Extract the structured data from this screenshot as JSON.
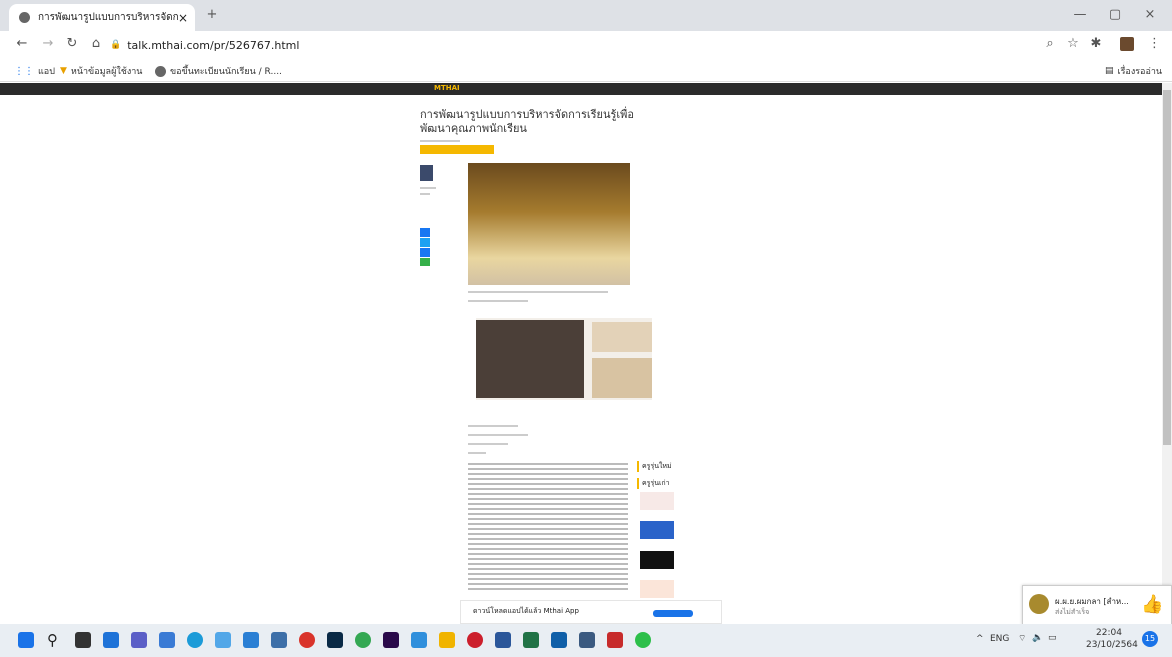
{
  "browser": {
    "tab_title": "การพัฒนารูปแบบการบริหารจัดการเรียนรู้",
    "tab_close": "×",
    "new_tab": "+",
    "url": "talk.mthai.com/pr/526767.html",
    "window_min": "—",
    "window_max": "▢",
    "window_close": "×",
    "bookmarks": [
      "แอป",
      "หน้าข้อมูลผู้ใช้งาน",
      "ขอขึ้นทะเบียนนักเรียน / R...."
    ],
    "reading_list": "เรื่องรออ่าน"
  },
  "page": {
    "site_logo": "MTHAI",
    "title": "การพัฒนารูปแบบการบริหารจัดการเรียนรู้เพื่อพัฒนาคุณภาพนักเรียน",
    "section_heading_1": "ครูรุ่นใหม่",
    "section_heading_2": "ครูรุ่นเก่า"
  },
  "app_banner": {
    "text": "ดาวน์โหลดแอปได้แล้ว Mthai App"
  },
  "taskbar": {
    "lang": "ENG",
    "time": "22:04",
    "date": "23/10/2564",
    "notif_count": "15"
  },
  "notification": {
    "title": "ผ.ผ.ย.ผมกลา [สำห...",
    "subtitle": "ส่งไม่สำเร็จ"
  },
  "colors": {
    "accent": "#f5b800",
    "sitebar": "#2b2b2b",
    "taskbar": "#e9eef3"
  }
}
